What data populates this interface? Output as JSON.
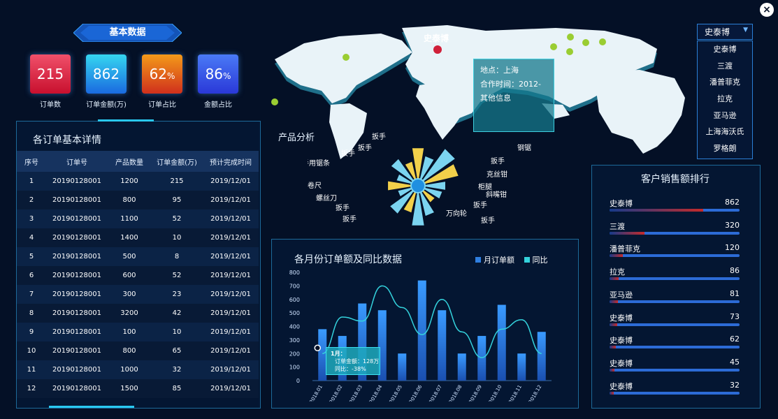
{
  "close_label": "×",
  "basic": {
    "title": "基本数据",
    "kpis": [
      {
        "value": "215",
        "unit": "",
        "label": "订单数",
        "color_top": "#f0506a",
        "color_bottom": "#c8102e"
      },
      {
        "value": "862",
        "unit": "",
        "label": "订单金额(万)",
        "color_top": "#35d6f0",
        "color_bottom": "#1a6ae0"
      },
      {
        "value": "62",
        "unit": "%",
        "label": "订单占比",
        "color_top": "#f39a1a",
        "color_bottom": "#d0301c"
      },
      {
        "value": "86",
        "unit": "%",
        "label": "金额占比",
        "color_top": "#4a7af6",
        "color_bottom": "#2a38d8"
      }
    ]
  },
  "orders": {
    "title": "各订单基本详情",
    "columns": [
      "序号",
      "订单号",
      "产品数量",
      "订单金额(万)",
      "预计完成时间"
    ],
    "rows": [
      [
        "1",
        "20190128001",
        "1200",
        "215",
        "2019/12/01"
      ],
      [
        "2",
        "20190128001",
        "800",
        "95",
        "2019/12/01"
      ],
      [
        "3",
        "20190128001",
        "1100",
        "52",
        "2019/12/01"
      ],
      [
        "4",
        "20190128001",
        "1400",
        "10",
        "2019/12/01"
      ],
      [
        "5",
        "20190128001",
        "500",
        "8",
        "2019/12/01"
      ],
      [
        "6",
        "20190128001",
        "600",
        "52",
        "2019/12/01"
      ],
      [
        "7",
        "20190128001",
        "300",
        "23",
        "2019/12/01"
      ],
      [
        "8",
        "20190128001",
        "3200",
        "42",
        "2019/12/01"
      ],
      [
        "9",
        "20190128001",
        "100",
        "10",
        "2019/12/01"
      ],
      [
        "10",
        "20190128001",
        "800",
        "65",
        "2019/12/01"
      ],
      [
        "11",
        "20190128001",
        "1000",
        "32",
        "2019/12/01"
      ],
      [
        "12",
        "20190128001",
        "1500",
        "85",
        "2019/12/01"
      ]
    ]
  },
  "map": {
    "city_label": "史泰博",
    "tooltip": {
      "line1": "地点：上海",
      "line2": "合作时间：2012-",
      "line3": "其他信息"
    }
  },
  "dropdown": {
    "selected": "史泰博",
    "arrow": "▼",
    "options": [
      "史泰博",
      "三渡",
      "潘普菲克",
      "拉克",
      "亚马逊",
      "上海海沃氏",
      "罗格朗"
    ]
  },
  "product": {
    "title": "产品分析",
    "labels": [
      "扳手",
      "扳手",
      "扳手",
      "手用锯条",
      "卷尺",
      "螺丝刀",
      "扳手",
      "扳手",
      "钢锯",
      "扳手",
      "克丝钳",
      "柜腿",
      "斜嘴钳",
      "扳手",
      "万向轮",
      "扳手"
    ]
  },
  "ranking": {
    "title": "客户销售额排行",
    "rows": [
      {
        "name": "史泰博",
        "value": "862",
        "fill": 100
      },
      {
        "name": "三渡",
        "value": "320",
        "fill": 37
      },
      {
        "name": "潘普菲克",
        "value": "120",
        "fill": 14
      },
      {
        "name": "拉克",
        "value": "86",
        "fill": 10
      },
      {
        "name": "亚马逊",
        "value": "81",
        "fill": 9
      },
      {
        "name": "史泰博",
        "value": "73",
        "fill": 8
      },
      {
        "name": "史泰博",
        "value": "62",
        "fill": 7
      },
      {
        "name": "史泰博",
        "value": "45",
        "fill": 5
      },
      {
        "name": "史泰博",
        "value": "32",
        "fill": 4
      }
    ]
  },
  "colors": {
    "bar": "#2f7fe0",
    "line": "#34d2dc",
    "panel_border": "#1d6a9a"
  },
  "chart_data": {
    "type": "bar",
    "title": "各月份订单额及同比数据",
    "categories": [
      "2018.01",
      "2018.02",
      "2018.03",
      "2018.04",
      "2018.05",
      "2018.06",
      "2018.07",
      "2018.08",
      "2018.09",
      "2018.10",
      "2018.11",
      "2018.12"
    ],
    "series": [
      {
        "name": "月订单额",
        "type": "bar",
        "values": [
          380,
          330,
          570,
          520,
          200,
          740,
          520,
          200,
          330,
          560,
          200,
          360
        ]
      },
      {
        "name": "同比",
        "type": "line",
        "values": [
          200,
          470,
          440,
          700,
          540,
          340,
          600,
          360,
          170,
          380,
          450,
          200
        ]
      }
    ],
    "ylim": [
      0,
      800
    ],
    "yticks": [
      "800",
      "700",
      "600",
      "500",
      "400",
      "300",
      "200",
      "100",
      "0"
    ],
    "legend": "top-right",
    "tooltip": {
      "title": "1月：",
      "line1": "订单金额：128万",
      "line2": "同比：-38%"
    }
  }
}
